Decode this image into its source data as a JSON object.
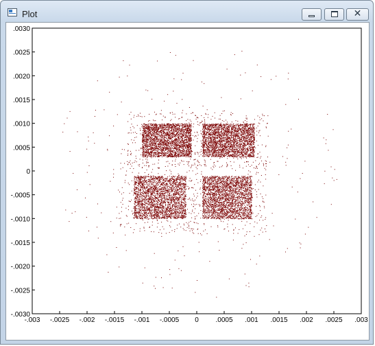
{
  "window": {
    "title": "Plot",
    "icon": "app-window-icon",
    "controls": {
      "minimize": "minimize-icon",
      "maximize": "maximize-icon",
      "close": "✕"
    }
  },
  "chart_data": {
    "type": "scatter",
    "title": "",
    "xlabel": "",
    "ylabel": "",
    "xlim": [
      -0.003,
      0.003
    ],
    "ylim": [
      -0.003,
      0.003
    ],
    "x_ticks": [
      -0.003,
      -0.0025,
      -0.002,
      -0.0015,
      -0.001,
      -0.0005,
      0,
      0.0005,
      0.001,
      0.0015,
      0.002,
      0.0025,
      0.003
    ],
    "x_tick_labels": [
      "-.003",
      "-.0025",
      "-.002",
      "-.0015",
      "-.001",
      "-.0005",
      "0",
      ".0005",
      ".001",
      ".0015",
      ".002",
      ".0025",
      ".003"
    ],
    "y_ticks": [
      0.003,
      0.0025,
      0.002,
      0.0015,
      0.001,
      0.0005,
      0,
      -0.0005,
      -0.001,
      -0.0015,
      -0.002,
      -0.0025,
      -0.003
    ],
    "y_tick_labels": [
      ".0030",
      ".0025",
      ".0020",
      ".0015",
      ".0010",
      ".0005",
      "0",
      "-.0005",
      "-.0010",
      "-.0015",
      "-.0020",
      "-.0025",
      "-.0030"
    ],
    "grid": false,
    "legend": "none",
    "marker_color": "#7a0000",
    "series": [
      {
        "cluster": "upper-left",
        "x_range": [
          -0.001,
          -0.0001
        ],
        "y_range": [
          0.0003,
          0.001
        ]
      },
      {
        "cluster": "upper-right",
        "x_range": [
          0.0001,
          0.00105
        ],
        "y_range": [
          0.0003,
          0.001
        ]
      },
      {
        "cluster": "lower-left",
        "x_range": [
          -0.00115,
          -0.0002
        ],
        "y_range": [
          -0.001,
          -0.0001
        ]
      },
      {
        "cluster": "lower-right",
        "x_range": [
          0.0001,
          0.001
        ],
        "y_range": [
          -0.001,
          -0.0001
        ]
      }
    ]
  }
}
